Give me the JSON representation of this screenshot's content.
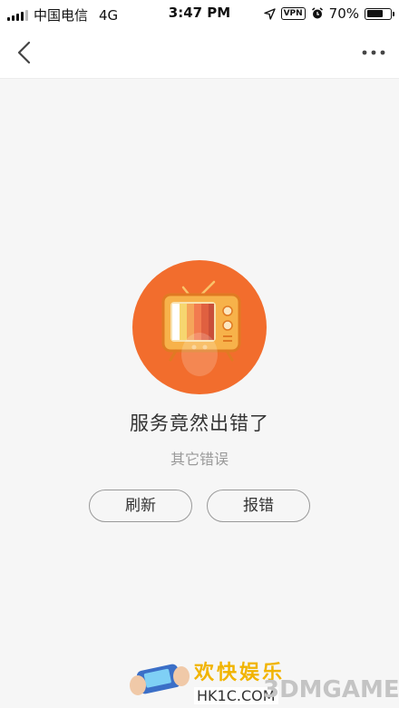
{
  "status_bar": {
    "carrier": "中国电信",
    "network": "4G",
    "time": "3:47 PM",
    "vpn_label": "VPN",
    "battery_percent_text": "70%",
    "battery_level": 0.7
  },
  "nav": {
    "back_icon": "chevron-left-icon",
    "more_icon": "more-dots-icon"
  },
  "error": {
    "title": "服务竟然出错了",
    "subtitle": "其它错误",
    "illustration_colors": {
      "circle": "#f26d2d",
      "tv": "#f7b24a"
    }
  },
  "actions": {
    "refresh_label": "刷新",
    "report_label": "报错"
  },
  "watermark": {
    "title": "欢快娱乐",
    "domain": "HK1C.COM",
    "brand": "3DMGAME"
  }
}
